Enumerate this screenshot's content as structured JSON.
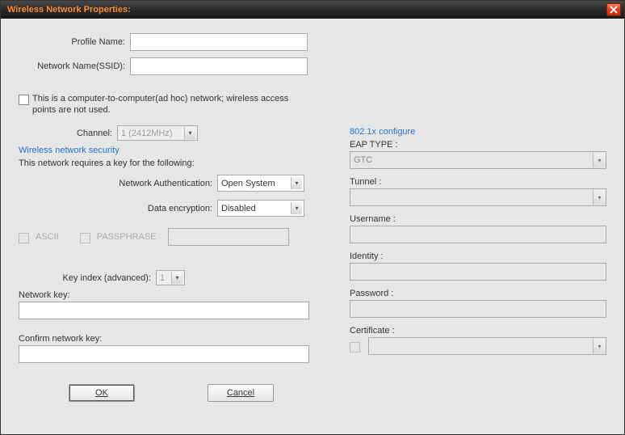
{
  "window_title": "Wireless Network Properties:",
  "labels": {
    "profile_name": "Profile Name:",
    "network_name": "Network Name(SSID):",
    "adhoc": "This is a computer-to-computer(ad hoc) network; wireless access points are not used.",
    "channel": "Channel:",
    "channel_value": "1  (2412MHz)",
    "security_title": "Wireless network security",
    "security_desc": "This network requires a key for the following:",
    "net_auth": "Network Authentication:",
    "net_auth_value": "Open System",
    "data_enc": "Data encryption:",
    "data_enc_value": "Disabled",
    "ascii": "ASCII",
    "passphrase": "PASSPHRASE",
    "key_index": "Key index (advanced):",
    "key_index_value": "1",
    "network_key": "Network key:",
    "confirm_key": "Confirm network key:",
    "ok": "OK",
    "cancel": "Cancel"
  },
  "right": {
    "title": "802.1x configure",
    "eap_type": "EAP TYPE :",
    "eap_value": "GTC",
    "tunnel": "Tunnel :",
    "username": "Username :",
    "identity": "Identity :",
    "password": "Password :",
    "certificate": "Certificate :"
  }
}
